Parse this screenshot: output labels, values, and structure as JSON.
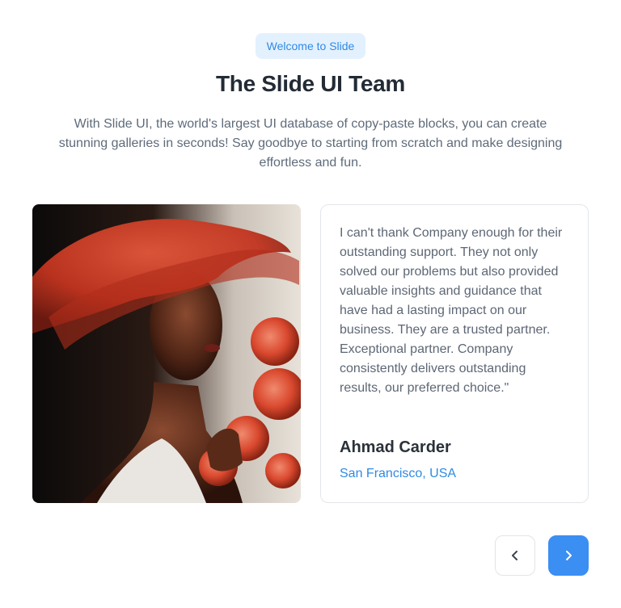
{
  "header": {
    "badge": "Welcome to Slide",
    "title": "The Slide UI Team",
    "subtitle": "With Slide UI, the world's largest UI database of copy-paste blocks, you can create stunning galleries in seconds! Say goodbye to starting from scratch and make designing effortless and fun."
  },
  "testimonial": {
    "quote": "I can't thank Company enough for their outstanding support. They not only solved our problems but also provided valuable insights and guidance that have had a lasting impact on our business. They are a trusted partner. Exceptional partner. Company consistently delivers outstanding results, our preferred choice.\"",
    "name": "Ahmad Carder",
    "location": "San Francisco, USA"
  },
  "navigation": {
    "prev_icon": "chevron-left-icon",
    "next_icon": "chevron-right-icon"
  },
  "colors": {
    "accent": "#3b8ef2",
    "badge_bg": "#e3f1fe",
    "link": "#2f8ae5"
  }
}
